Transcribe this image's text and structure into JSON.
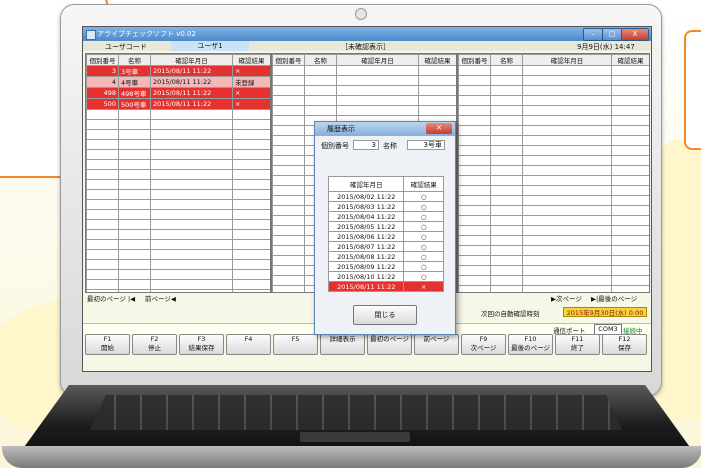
{
  "window": {
    "title": "アライブチェックソフト v0.02",
    "min": "–",
    "max": "□",
    "close": "X"
  },
  "topbar": {
    "user_code_label": "ユーザコード",
    "user_code_value": "ユーザ1",
    "mode": "［未確認表示］",
    "datetime": "9月9日(水) 14:47"
  },
  "columns": [
    "個別番号",
    "名称",
    "確認年月日",
    "確認結果"
  ],
  "panel1": {
    "rows": [
      {
        "id": "3",
        "name": "3号車",
        "date": "2015/08/11 11:22",
        "result": "×",
        "state": "red"
      },
      {
        "id": "4",
        "name": "4号車",
        "date": "2015/08/11 11:22",
        "result": "未登録",
        "state": "pink"
      },
      {
        "id": "498",
        "name": "498号車",
        "date": "2015/08/11 11:22",
        "result": "×",
        "state": "red"
      },
      {
        "id": "500",
        "name": "500号車",
        "date": "2015/08/11 11:22",
        "result": "×",
        "state": "red"
      }
    ]
  },
  "pager": {
    "first": "最初のページ",
    "prev": "前ページ",
    "next": "▶次ページ",
    "last": "最後のページ"
  },
  "auto": {
    "label": "次回の自動確認時刻",
    "value": "2015年9月30日(水) 0:00"
  },
  "comm": {
    "label": "通信ポート",
    "port": "COM3",
    "status": "接続中"
  },
  "status_text": "メ",
  "fkeys": [
    {
      "key": "F1",
      "label": "開始"
    },
    {
      "key": "F2",
      "label": "停止"
    },
    {
      "key": "F3",
      "label": "結果保存"
    },
    {
      "key": "F4",
      "label": ""
    },
    {
      "key": "F5",
      "label": ""
    },
    {
      "key": "",
      "label": "詳細表示"
    },
    {
      "key": "",
      "label": "最初のページ"
    },
    {
      "key": "",
      "label": "前ページ"
    },
    {
      "key": "F9",
      "label": "次ページ"
    },
    {
      "key": "F10",
      "label": "最後のページ"
    },
    {
      "key": "F11",
      "label": "終了"
    },
    {
      "key": "F12",
      "label": "保存"
    }
  ],
  "dialog": {
    "title": "履歴表示",
    "id_label": "個別番号",
    "id_value": "3",
    "name_label": "名称",
    "name_value": "3号車",
    "col_date": "確認年月日",
    "col_result": "確認結果",
    "rows": [
      {
        "date": "2015/08/02 11:22",
        "result": "○"
      },
      {
        "date": "2015/08/03 11:22",
        "result": "○"
      },
      {
        "date": "2015/08/04 11:22",
        "result": "○"
      },
      {
        "date": "2015/08/05 11:22",
        "result": "○"
      },
      {
        "date": "2015/08/06 11:22",
        "result": "○"
      },
      {
        "date": "2015/08/07 11:22",
        "result": "○"
      },
      {
        "date": "2015/08/08 11:22",
        "result": "○"
      },
      {
        "date": "2015/08/09 11:22",
        "result": "○"
      },
      {
        "date": "2015/08/10 11:22",
        "result": "○"
      },
      {
        "date": "2015/08/11 11:22",
        "result": "×"
      }
    ],
    "close_label": "閉じる"
  }
}
